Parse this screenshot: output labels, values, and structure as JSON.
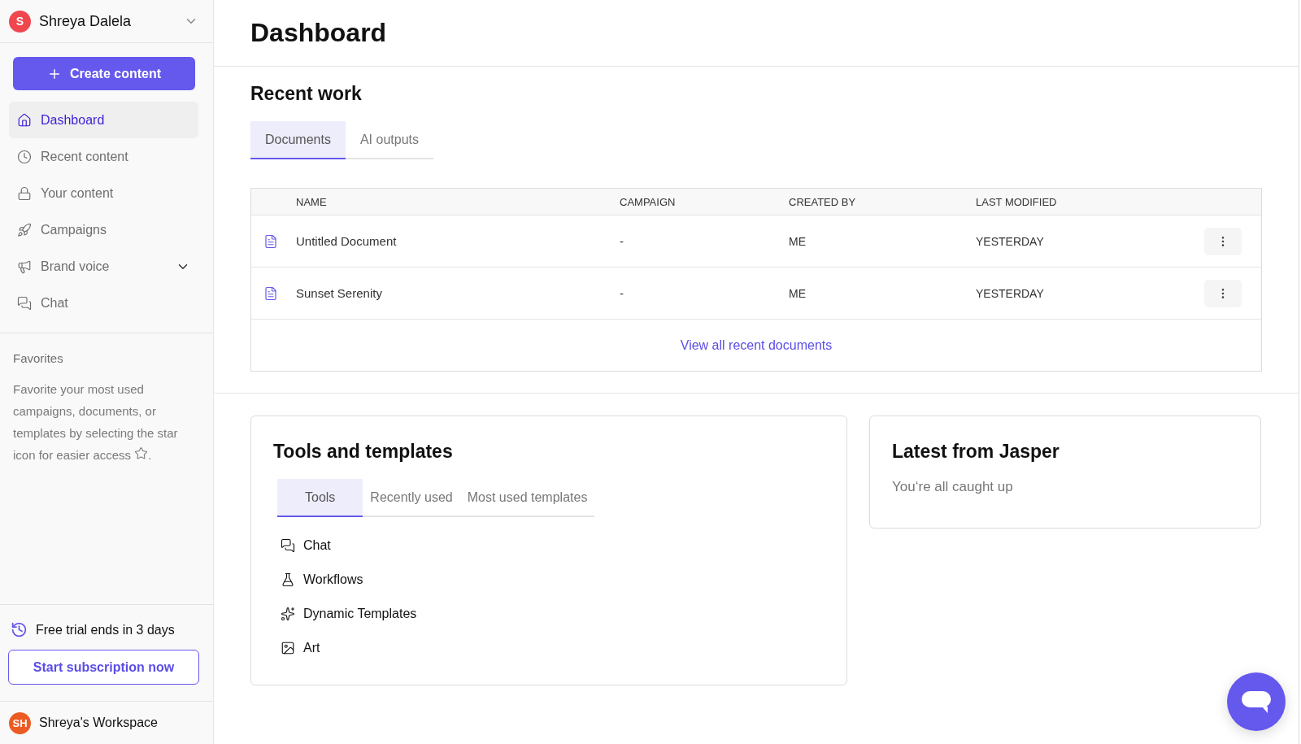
{
  "sidebar": {
    "user": {
      "initial": "S",
      "name": "Shreya Dalela"
    },
    "create_button": "Create content",
    "nav_items": [
      {
        "label": "Dashboard",
        "selected": true
      },
      {
        "label": "Recent content",
        "selected": false
      },
      {
        "label": "Your content",
        "selected": false
      },
      {
        "label": "Campaigns",
        "selected": false
      },
      {
        "label": "Brand voice",
        "selected": false,
        "expanded": false
      },
      {
        "label": "Chat",
        "selected": false
      }
    ],
    "favorites": {
      "title": "Favorites",
      "hint": "Favorite your most used campaigns, documents, or templates by selecting the star",
      "hint_tail": "icon for easier access",
      "hint_end": "."
    },
    "trial": {
      "text": "Free trial ends in 3 days",
      "button": "Start subscription now"
    },
    "workspace": {
      "initials": "SH",
      "name": "Shreya's Workspace"
    }
  },
  "page_title": "Dashboard",
  "recent_work": {
    "title": "Recent work",
    "tabs": [
      {
        "label": "Documents",
        "selected": true
      },
      {
        "label": "AI outputs",
        "selected": false
      }
    ],
    "table": {
      "columns": [
        "NAME",
        "CAMPAIGN",
        "CREATED BY",
        "LAST MODIFIED"
      ],
      "rows": [
        {
          "name": "Untitled Document",
          "campaign": "-",
          "created_by": "ME",
          "last_modified": "YESTERDAY"
        },
        {
          "name": "Sunset Serenity",
          "campaign": "-",
          "created_by": "ME",
          "last_modified": "YESTERDAY"
        }
      ],
      "footer_link": "View all recent documents"
    }
  },
  "tools": {
    "title": "Tools and templates",
    "tabs": [
      {
        "label": "Tools",
        "selected": true
      },
      {
        "label": "Recently used",
        "selected": false
      },
      {
        "label": "Most used templates",
        "selected": false
      }
    ],
    "items": [
      "Chat",
      "Workflows",
      "Dynamic Templates",
      "Art"
    ]
  },
  "latest": {
    "title": "Latest from Jasper",
    "message": "You‘re all caught up"
  }
}
